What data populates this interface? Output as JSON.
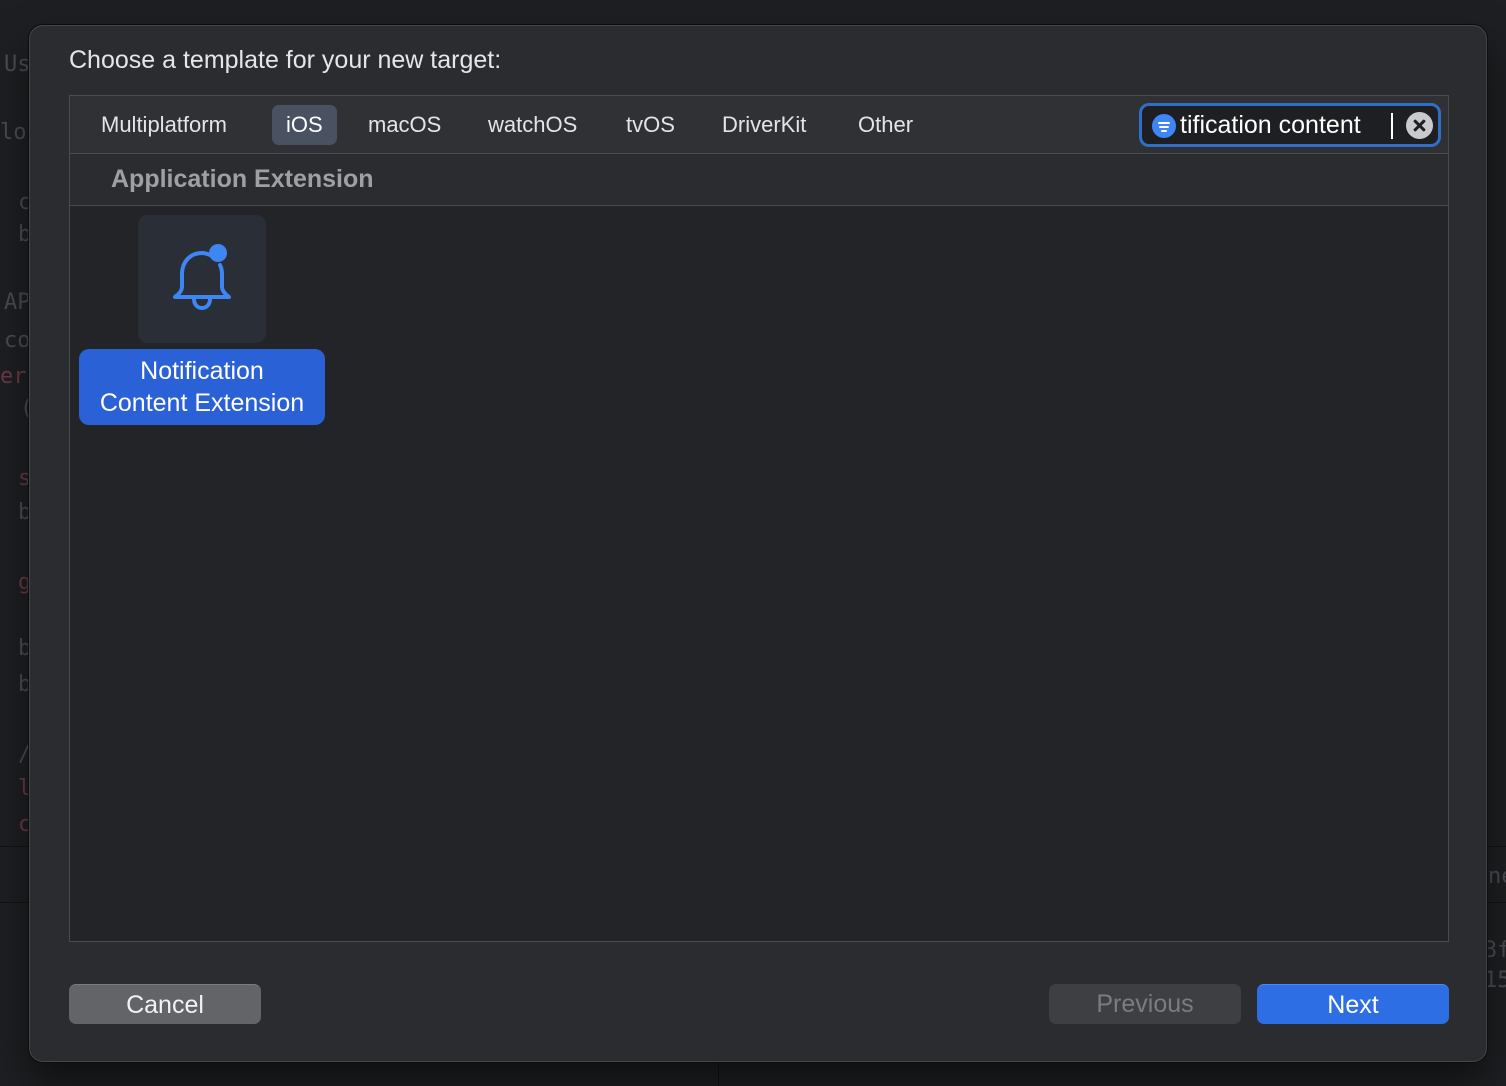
{
  "background": {
    "fragments": [
      "Us",
      "lot",
      "c",
      "b",
      "AP",
      "co",
      "err",
      "(",
      "s",
      "b",
      "g",
      "b",
      "b",
      "/",
      "l",
      "c",
      "ne",
      "3f",
      "15"
    ]
  },
  "dialog": {
    "title": "Choose a template for your new target:"
  },
  "platform_tabs": [
    {
      "label": "Multiplatform",
      "selected": false
    },
    {
      "label": "iOS",
      "selected": true
    },
    {
      "label": "macOS",
      "selected": false
    },
    {
      "label": "watchOS",
      "selected": false
    },
    {
      "label": "tvOS",
      "selected": false
    },
    {
      "label": "DriverKit",
      "selected": false
    },
    {
      "label": "Other",
      "selected": false
    }
  ],
  "search": {
    "value": "tification content",
    "icon": "filter-icon",
    "clear_icon": "clear-icon"
  },
  "section": {
    "title": "Application Extension"
  },
  "templates": [
    {
      "label_line1": "Notification",
      "label_line2": "Content Extension",
      "icon": "bell-badge-icon",
      "selected": true
    }
  ],
  "buttons": {
    "cancel": "Cancel",
    "previous": "Previous",
    "next": "Next"
  },
  "colors": {
    "accent": "#2e6ee5",
    "selection": "#2a61d6",
    "sheet_background": "#2b2c30",
    "icon_blue": "#3d86f4"
  }
}
